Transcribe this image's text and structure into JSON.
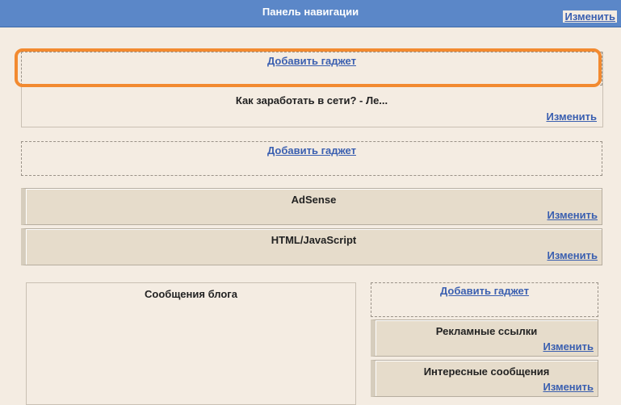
{
  "header": {
    "title": "Панель навигации",
    "edit_label": "Изменить"
  },
  "top_section": {
    "add_gadget_label": "Добавить гаджет",
    "gadget_title": "Как заработать в сети? - Ле...",
    "edit_label": "Изменить"
  },
  "section2": {
    "add_gadget_label": "Добавить гаджет",
    "gadgets": [
      {
        "title": "AdSense",
        "edit_label": "Изменить"
      },
      {
        "title": "HTML/JavaScript",
        "edit_label": "Изменить"
      }
    ]
  },
  "main_column": {
    "title": "Сообщения блога"
  },
  "sidebar": {
    "add_gadget_label": "Добавить гаджет",
    "gadgets": [
      {
        "title": "Рекламные ссылки",
        "edit_label": "Изменить"
      },
      {
        "title": "Интересные сообщения",
        "edit_label": "Изменить"
      }
    ]
  },
  "colors": {
    "accent": "#5b87c8",
    "highlight": "#f28a30",
    "link": "#3a5fb0"
  }
}
